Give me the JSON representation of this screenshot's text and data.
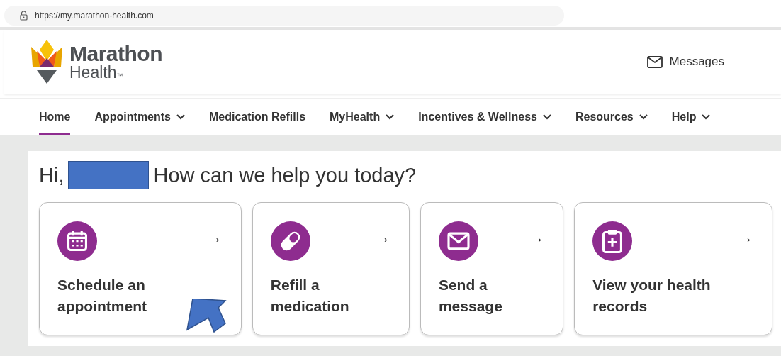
{
  "address_bar": {
    "url": "https://my.marathon-health.com"
  },
  "logo": {
    "name": "Marathon",
    "sub": "Health",
    "mark": "™"
  },
  "header": {
    "messages": "Messages"
  },
  "nav": [
    {
      "label": "Home",
      "selected": true,
      "dropdown": false
    },
    {
      "label": "Appointments",
      "selected": false,
      "dropdown": true
    },
    {
      "label": "Medication Refills",
      "selected": false,
      "dropdown": false
    },
    {
      "label": "MyHealth",
      "selected": false,
      "dropdown": true
    },
    {
      "label": "Incentives & Wellness",
      "selected": false,
      "dropdown": true
    },
    {
      "label": "Resources",
      "selected": false,
      "dropdown": true
    },
    {
      "label": "Help",
      "selected": false,
      "dropdown": true
    }
  ],
  "greeting": {
    "hello": "Hi,",
    "question": "How can we help you today?"
  },
  "cards": [
    {
      "kind": "calendar",
      "title": "Schedule an appointment",
      "arrow": "→"
    },
    {
      "kind": "pill",
      "title": "Refill a medication",
      "arrow": "→"
    },
    {
      "kind": "mail",
      "title": "Send a message",
      "arrow": "→"
    },
    {
      "kind": "clipboard",
      "title": "View your health records",
      "arrow": "→"
    }
  ]
}
